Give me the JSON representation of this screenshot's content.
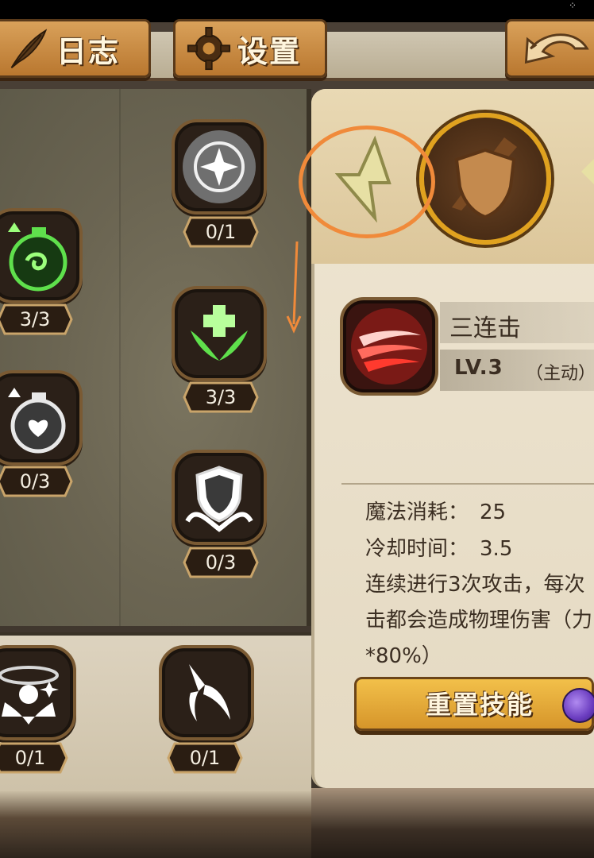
{
  "tabs": {
    "log_label": "日志",
    "settings_label": "设置"
  },
  "skill_tree": {
    "items": [
      {
        "name": "radiant-star",
        "count": "0/1",
        "color": "#d8d8d8"
      },
      {
        "name": "potion-swirl",
        "count": "3/3",
        "color": "#5fe04c"
      },
      {
        "name": "holy-cross-wings",
        "count": "3/3",
        "color": "#5fe04c"
      },
      {
        "name": "potion-heart",
        "count": "0/3",
        "color": "#d8d8d8"
      },
      {
        "name": "shield-guard",
        "count": "0/3",
        "color": "#d8d8d8"
      },
      {
        "name": "levitate-aura",
        "count": "0/1",
        "color": "#d8d8d8"
      },
      {
        "name": "scissor-blade",
        "count": "0/1",
        "color": "#d8d8d8"
      }
    ]
  },
  "detail": {
    "skill_name": "三连击",
    "skill_level": "LV.3",
    "skill_type": "（主动）",
    "mana_label": "魔法消耗：",
    "mana_value": "25",
    "cooldown_label": "冷却时间：",
    "cooldown_value": "3.5",
    "description": "连续进行3次攻击，每次击都会造成物理伤害（力*80%）",
    "reset_label": "重置技能"
  },
  "colors": {
    "highlight": "#f08a3a",
    "gold": "#e0a21f",
    "active_green": "#5fe04c"
  }
}
